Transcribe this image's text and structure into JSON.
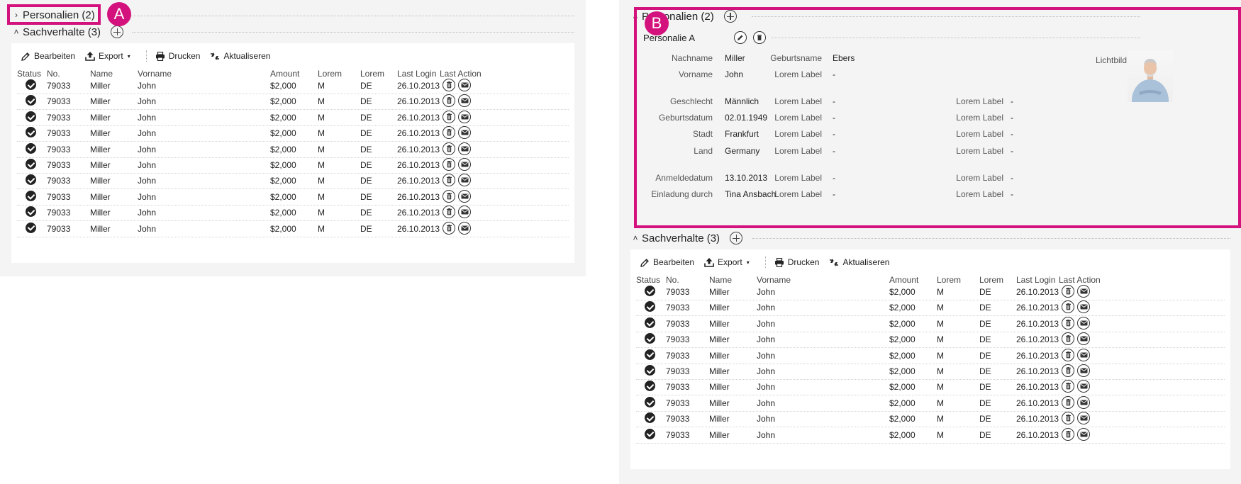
{
  "panelA": {
    "personalien": {
      "title": "Personalien (2)"
    },
    "sachverhalte": {
      "title": "Sachverhalte (3)"
    },
    "badge": "A"
  },
  "panelB": {
    "personalien": {
      "title": "Personalien (2)"
    },
    "personalie": {
      "title": "Personalie A"
    },
    "sachverhalte": {
      "title": "Sachverhalte (3)"
    },
    "badge": "B",
    "photo_label": "Lichtbild",
    "details": [
      {
        "label": "Nachname",
        "value": "Miller"
      },
      {
        "label": "Vorname",
        "value": "John"
      },
      {
        "label": "Geschlecht",
        "value": "Männlich"
      },
      {
        "label": "Geburtsdatum",
        "value": "02.01.1949"
      },
      {
        "label": "Stadt",
        "value": "Frankfurt"
      },
      {
        "label": "Land",
        "value": "Germany"
      },
      {
        "label": "Anmeldedatum",
        "value": "13.10.2013"
      },
      {
        "label": "Einladung durch",
        "value": "Tina Ansbach"
      }
    ],
    "details2": [
      {
        "label": "Geburtsname",
        "value": "Ebers"
      },
      {
        "label": "Lorem Label",
        "value": "-"
      },
      {
        "label": "Lorem Label",
        "value": "-"
      },
      {
        "label": "Lorem Label",
        "value": "-"
      },
      {
        "label": "Lorem Label",
        "value": "-"
      },
      {
        "label": "Lorem Label",
        "value": "-"
      },
      {
        "label": "Lorem Label",
        "value": "-"
      },
      {
        "label": "Lorem Label",
        "value": "-"
      }
    ],
    "details3": [
      {
        "label": "Lorem Label",
        "value": "-"
      },
      {
        "label": "Lorem Label",
        "value": "-"
      },
      {
        "label": "Lorem Label",
        "value": "-"
      },
      {
        "label": "Lorem Label",
        "value": "-"
      },
      {
        "label": "Lorem Label",
        "value": "-"
      },
      {
        "label": "Lorem Label",
        "value": "-"
      }
    ]
  },
  "toolbar": {
    "edit": "Bearbeiten",
    "export": "Export",
    "print": "Drucken",
    "refresh": "Aktualiseren"
  },
  "table": {
    "headers": [
      "Status",
      "No.",
      "Name",
      "Vorname",
      "Amount",
      "Lorem",
      "Lorem",
      "Last Login",
      "Last Action"
    ],
    "rows": [
      [
        "79033",
        "Miller",
        "John",
        "$2,000",
        "M",
        "DE",
        "26.10.2013"
      ],
      [
        "79033",
        "Miller",
        "John",
        "$2,000",
        "M",
        "DE",
        "26.10.2013"
      ],
      [
        "79033",
        "Miller",
        "John",
        "$2,000",
        "M",
        "DE",
        "26.10.2013"
      ],
      [
        "79033",
        "Miller",
        "John",
        "$2,000",
        "M",
        "DE",
        "26.10.2013"
      ],
      [
        "79033",
        "Miller",
        "John",
        "$2,000",
        "M",
        "DE",
        "26.10.2013"
      ],
      [
        "79033",
        "Miller",
        "John",
        "$2,000",
        "M",
        "DE",
        "26.10.2013"
      ],
      [
        "79033",
        "Miller",
        "John",
        "$2,000",
        "M",
        "DE",
        "26.10.2013"
      ],
      [
        "79033",
        "Miller",
        "John",
        "$2,000",
        "M",
        "DE",
        "26.10.2013"
      ],
      [
        "79033",
        "Miller",
        "John",
        "$2,000",
        "M",
        "DE",
        "26.10.2013"
      ],
      [
        "79033",
        "Miller",
        "John",
        "$2,000",
        "M",
        "DE",
        "26.10.2013"
      ]
    ]
  },
  "colors": {
    "highlight": "#d4127d"
  }
}
